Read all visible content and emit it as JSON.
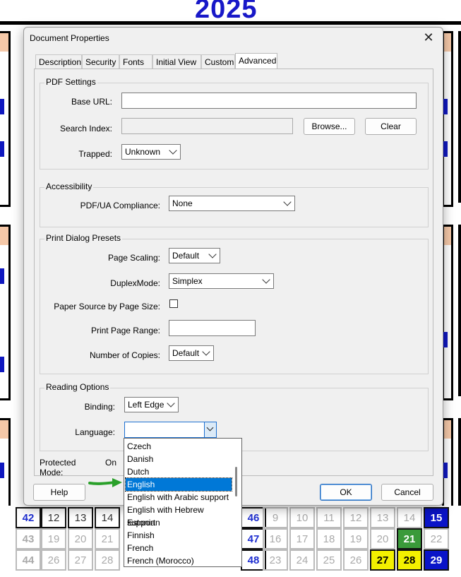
{
  "background": {
    "year": "2025",
    "bottom_rows": [
      [
        "42",
        "12",
        "13",
        "14",
        "",
        "46",
        "9",
        "10",
        "11",
        "12",
        "13",
        "14",
        "15"
      ],
      [
        "43",
        "19",
        "20",
        "21",
        "",
        "47",
        "16",
        "17",
        "18",
        "19",
        "20",
        "21",
        "22"
      ],
      [
        "44",
        "26",
        "27",
        "28",
        "",
        "48",
        "23",
        "24",
        "25",
        "26",
        "27",
        "28",
        "29"
      ]
    ]
  },
  "dialog": {
    "title": "Document Properties",
    "tabs": [
      "Description",
      "Security",
      "Fonts",
      "Initial View",
      "Custom",
      "Advanced"
    ],
    "active_tab": "Advanced",
    "pdf_settings": {
      "heading": "PDF Settings",
      "base_url_label": "Base URL:",
      "base_url_value": "",
      "search_index_label": "Search Index:",
      "browse_label": "Browse...",
      "clear_label": "Clear",
      "trapped_label": "Trapped:",
      "trapped_value": "Unknown"
    },
    "accessibility": {
      "heading": "Accessibility",
      "pdfua_label": "PDF/UA Compliance:",
      "pdfua_value": "None"
    },
    "print_presets": {
      "heading": "Print Dialog Presets",
      "page_scaling_label": "Page Scaling:",
      "page_scaling_value": "Default",
      "duplex_label": "DuplexMode:",
      "duplex_value": "Simplex",
      "paper_source_label": "Paper Source by Page Size:",
      "paper_source_checked": false,
      "print_range_label": "Print Page Range:",
      "print_range_value": "",
      "copies_label": "Number of Copies:",
      "copies_value": "Default"
    },
    "reading_options": {
      "heading": "Reading Options",
      "binding_label": "Binding:",
      "binding_value": "Left Edge",
      "language_label": "Language:",
      "language_value": "",
      "language_options": [
        "Czech",
        "Danish",
        "Dutch",
        "English",
        "English with Arabic support",
        "English with Hebrew support",
        "Estonian",
        "Finnish",
        "French",
        "French (Morocco)"
      ],
      "language_highlighted": "English"
    },
    "protected_mode_label": "Protected Mode:",
    "protected_mode_value": "On",
    "help_label": "Help",
    "ok_label": "OK",
    "cancel_label": "Cancel"
  },
  "colors": {
    "accent": "#0078d7",
    "calendar_blue": "#1818c8",
    "annotation_arrow": "#2aa02a"
  }
}
